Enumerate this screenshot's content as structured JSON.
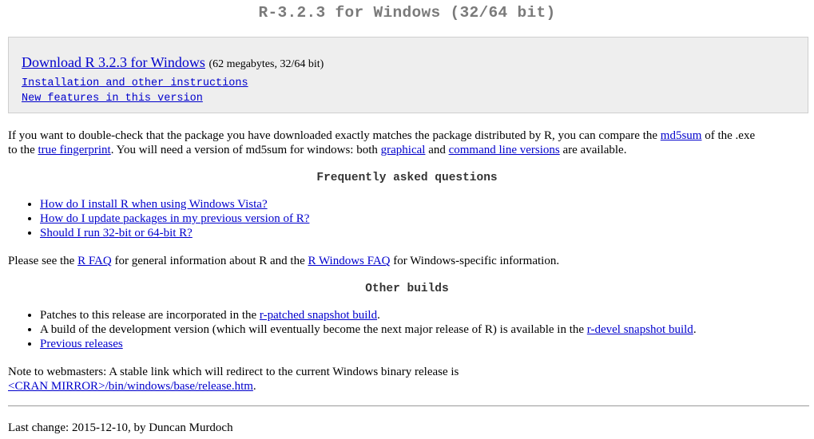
{
  "title": "R-3.2.3 for Windows (32/64 bit)",
  "download_box": {
    "main_link": "Download R 3.2.3 for Windows",
    "size_note": "(62 megabytes, 32/64 bit)",
    "instructions_link": "Installation and other instructions",
    "features_link": "New features in this version"
  },
  "md5_para": {
    "t1": "If you want to double-check that the package you have downloaded exactly matches the package distributed by R, you can compare the ",
    "md5sum_link": "md5sum",
    "t2": " of the .exe",
    "t3": "to the ",
    "fingerprint_link": "true fingerprint",
    "t4": ". You will need a version of md5sum for windows: both ",
    "graphical_link": "graphical",
    "t5": " and ",
    "cmdline_link": "command line versions",
    "t6": " are available."
  },
  "faq": {
    "heading": "Frequently asked questions",
    "items": [
      "How do I install R when using Windows Vista?",
      "How do I update packages in my previous version of R?",
      "Should I run 32-bit or 64-bit R?"
    ]
  },
  "faq_para": {
    "t1": "Please see the ",
    "rfaq_link": "R FAQ",
    "t2": " for general information about R and the ",
    "winfaq_link": "R Windows FAQ",
    "t3": " for Windows-specific information."
  },
  "builds": {
    "heading": "Other builds",
    "item1_text": "Patches to this release are incorporated in the ",
    "item1_link": "r-patched snapshot build",
    "item1_end": ".",
    "item2_text": "A build of the development version (which will eventually become the next major release of R) is available in the ",
    "item2_link": "r-devel snapshot build",
    "item2_end": ".",
    "item3_link": "Previous releases"
  },
  "webmasters": {
    "text": "Note to webmasters: A stable link which will redirect to the current Windows binary release is",
    "link": "<CRAN MIRROR>/bin/windows/base/release.htm",
    "end": "."
  },
  "footer": {
    "last_change": "Last change: 2015-12-10, by Duncan Murdoch"
  }
}
